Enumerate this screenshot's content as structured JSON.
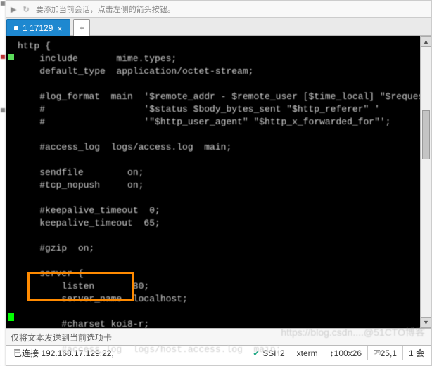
{
  "topbar": {
    "hint": "要添加当前会话，点击左侧的箭头按钮。",
    "reconnect_icon": "↻",
    "arrow_icon": "▶"
  },
  "tabs": {
    "active_label": "1 17129",
    "add_label": "+",
    "close_label": "×"
  },
  "terminal": {
    "lines": [
      "http {",
      "    include       mime.types;",
      "    default_type  application/octet-stream;",
      "",
      "    #log_format  main  '$remote_addr - $remote_user [$time_local] \"$request\" '",
      "    #                  '$status $body_bytes_sent \"$http_referer\" '",
      "    #                  '\"$http_user_agent\" \"$http_x_forwarded_for\"';",
      "",
      "    #access_log  logs/access.log  main;",
      "",
      "    sendfile        on;",
      "    #tcp_nopush     on;",
      "",
      "    #keepalive_timeout  0;",
      "    keepalive_timeout  65;",
      "",
      "    #gzip  on;",
      "",
      "    server {",
      "        listen       80;",
      "        server_name  localhost;",
      "",
      "        #charset koi8-r;",
      "",
      "        #access_log  logs/host.access.log  main;"
    ]
  },
  "sendbar": {
    "text": "仅将文本发送到当前选项卡"
  },
  "status": {
    "connection": "已连接 192.168.17.129:22,",
    "ssh": "SSH2",
    "term_type": "xterm",
    "size": "100x26",
    "cursor": "25,1",
    "sessions": "1 会",
    "ssh_icon": "✔"
  },
  "watermark": "https://blog.csdn....@51CTO博客"
}
